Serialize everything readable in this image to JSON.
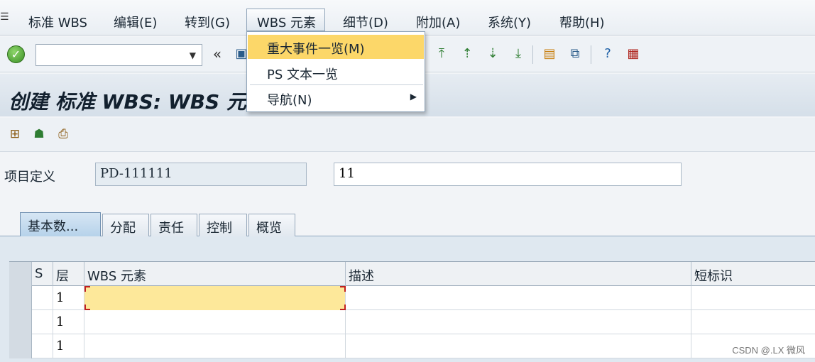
{
  "menubar": {
    "items": [
      "标准 WBS",
      "编辑(E)",
      "转到(G)",
      "WBS 元素",
      "细节(D)",
      "附加(A)",
      "系统(Y)",
      "帮助(H)"
    ]
  },
  "dropdown": {
    "items": [
      "重大事件一览(M)",
      "PS 文本一览",
      "导航(N)"
    ]
  },
  "toolbar": {
    "command_value": "",
    "icons": [
      "ok-icon",
      "back-icon",
      "save-icon",
      "first-page-icon",
      "prev-page-icon",
      "next-page-icon",
      "last-page-icon",
      "new-session-icon",
      "shortcut-icon",
      "help-icon",
      "customize-icon"
    ]
  },
  "page": {
    "title": "创建 标准 WBS: WBS 元"
  },
  "project": {
    "label": "项目定义",
    "id": "PD-111111",
    "description": "11"
  },
  "tabs": [
    "基本数...",
    "分配",
    "责任",
    "控制",
    "概览"
  ],
  "grid": {
    "headers": [
      "S",
      "层",
      "WBS 元素",
      "描述",
      "短标识"
    ],
    "rows": [
      {
        "level": "1",
        "wbs": "",
        "desc": "",
        "short": ""
      },
      {
        "level": "1",
        "wbs": "",
        "desc": "",
        "short": ""
      },
      {
        "level": "1",
        "wbs": "",
        "desc": "",
        "short": ""
      }
    ]
  },
  "watermark": "CSDN @.LX 微风",
  "colors": {
    "highlight": "#fcd769",
    "focus_cell": "#fde89a",
    "tab_selected": "#b6d2ea"
  }
}
